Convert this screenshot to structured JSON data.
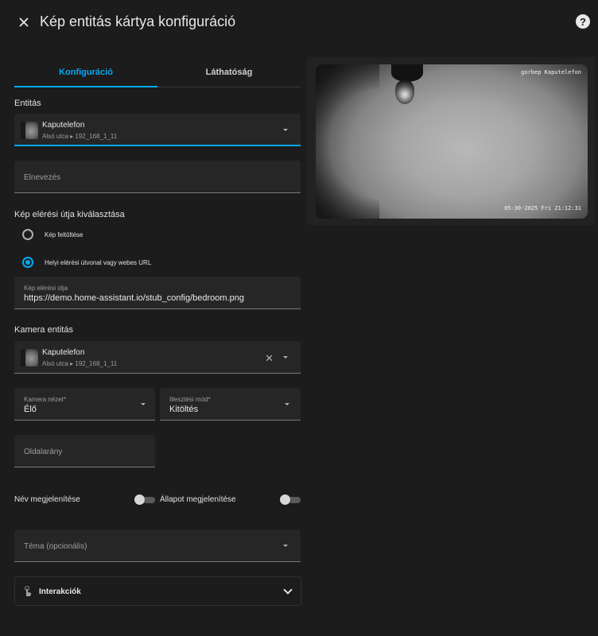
{
  "dialog": {
    "title": "Kép entitás kártya konfiguráció",
    "close_icon": "close-icon",
    "help_icon_glyph": "?"
  },
  "tabs": [
    {
      "label": "Konfiguráció",
      "active": true
    },
    {
      "label": "Láthatóság",
      "active": false
    }
  ],
  "entity_section": {
    "label": "Entitás",
    "entity_name": "Kaputelefon",
    "entity_sub": "Alsó utca ▸ 192_168_1_11"
  },
  "name_field": {
    "placeholder": "Elnevezés"
  },
  "image_path_section": {
    "label": "Kép elérési útja kiválasztása",
    "options": [
      {
        "label": "Kép feltöltése",
        "checked": false
      },
      {
        "label": "Helyi elérési útvonal vagy webes URL",
        "checked": true
      }
    ],
    "path_field_label": "Kép elérési útja",
    "path_field_value": "https://demo.home-assistant.io/stub_config/bedroom.png"
  },
  "camera_section": {
    "label": "Kamera entitás",
    "entity_name": "Kaputelefon",
    "entity_sub": "Alsó utca ▸ 192_168_1_11",
    "clear_glyph": "✕"
  },
  "camera_view": {
    "label": "Kamera nézet*",
    "value": "Élő"
  },
  "fit_mode": {
    "label": "Illesztési mód*",
    "value": "Kitöltés"
  },
  "aspect_ratio": {
    "placeholder": "Oldalarány"
  },
  "toggles": {
    "show_name": {
      "label": "Név megjelenítése",
      "on": false
    },
    "show_state": {
      "label": "Állapot megjelenítése",
      "on": false
    }
  },
  "theme_field": {
    "placeholder": "Téma (opcionális)"
  },
  "interactions": {
    "label": "Interakciók",
    "icon": "gesture-tap-icon"
  },
  "preview": {
    "camera_name": "gorbep Kaputelefon",
    "timestamp": "05-30-2025 Fri 21:12:31"
  },
  "colors": {
    "accent": "#03a9f4",
    "background": "#1c1c1c",
    "field": "#262626"
  }
}
